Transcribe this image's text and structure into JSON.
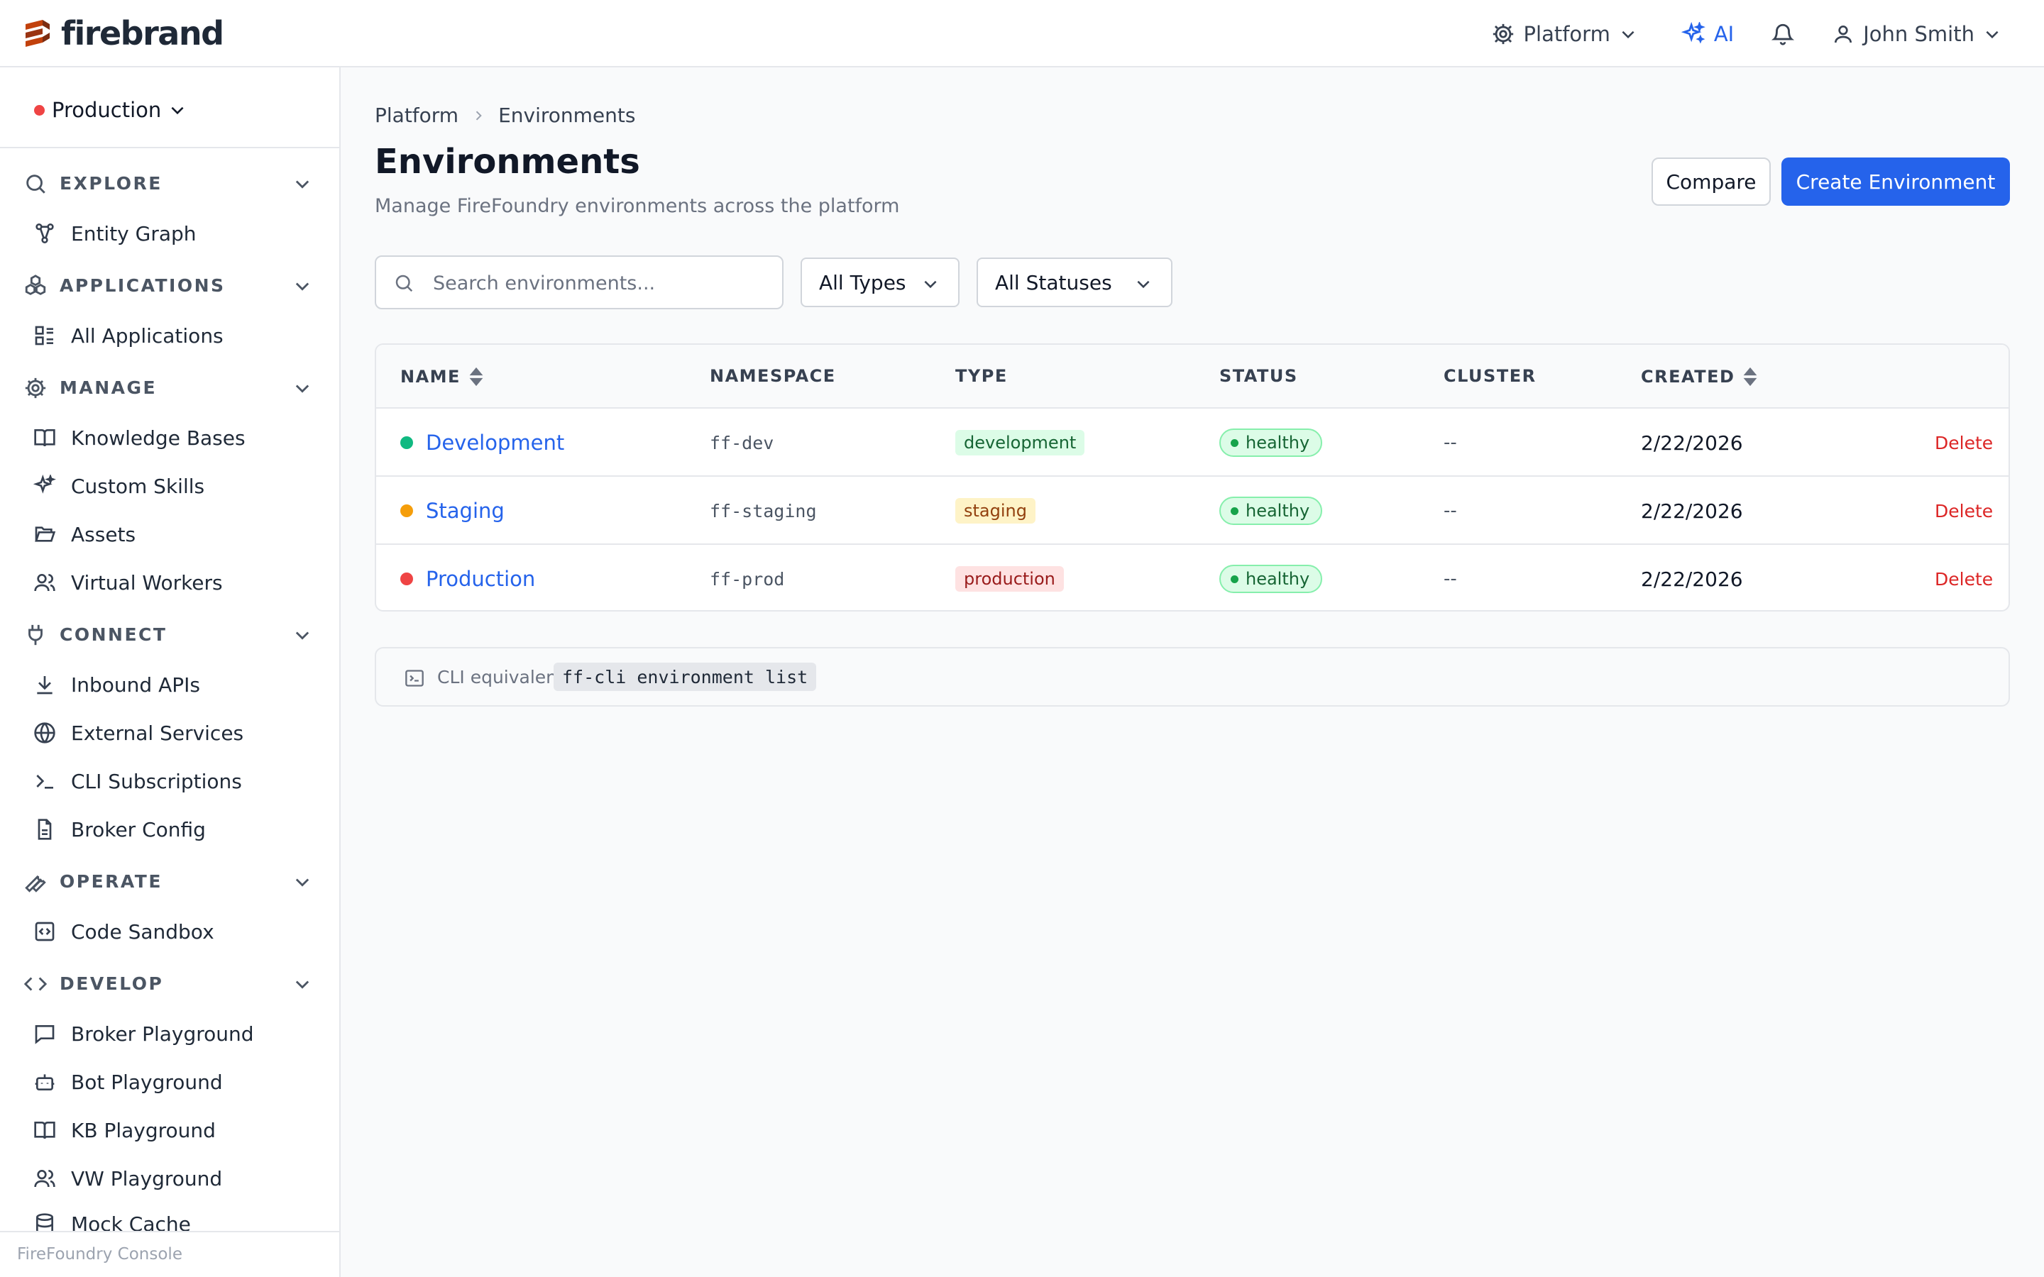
{
  "brand": {
    "name": "firebrand"
  },
  "topbar": {
    "platform_label": "Platform",
    "ai_label": "AI",
    "user_name": "John Smith"
  },
  "sidebar": {
    "environment": "Production",
    "groups": [
      {
        "label": "EXPLORE",
        "items": [
          "Entity Graph"
        ]
      },
      {
        "label": "APPLICATIONS",
        "items": [
          "All Applications"
        ]
      },
      {
        "label": "MANAGE",
        "items": [
          "Knowledge Bases",
          "Custom Skills",
          "Assets",
          "Virtual Workers"
        ]
      },
      {
        "label": "CONNECT",
        "items": [
          "Inbound APIs",
          "External Services",
          "CLI Subscriptions",
          "Broker Config"
        ]
      },
      {
        "label": "OPERATE",
        "items": [
          "Code Sandbox"
        ]
      },
      {
        "label": "DEVELOP",
        "items": [
          "Broker Playground",
          "Bot Playground",
          "KB Playground",
          "VW Playground",
          "Mock Cache"
        ]
      }
    ],
    "footer": "FireFoundry Console"
  },
  "breadcrumb": [
    "Platform",
    "Environments"
  ],
  "page": {
    "title": "Environments",
    "subtitle": "Manage FireFoundry environments across the platform",
    "compare_label": "Compare",
    "create_label": "Create Environment"
  },
  "filters": {
    "search_placeholder": "Search environments...",
    "type_value": "All Types",
    "status_value": "All Statuses"
  },
  "table": {
    "columns": [
      "NAME",
      "NAMESPACE",
      "TYPE",
      "STATUS",
      "CLUSTER",
      "CREATED"
    ],
    "rows": [
      {
        "name": "Development",
        "namespace": "ff-dev",
        "type": "development",
        "status": "healthy",
        "cluster": "--",
        "created": "2/22/2026",
        "action": "Delete"
      },
      {
        "name": "Staging",
        "namespace": "ff-staging",
        "type": "staging",
        "status": "healthy",
        "cluster": "--",
        "created": "2/22/2026",
        "action": "Delete"
      },
      {
        "name": "Production",
        "namespace": "ff-prod",
        "type": "production",
        "status": "healthy",
        "cluster": "--",
        "created": "2/22/2026",
        "action": "Delete"
      }
    ]
  },
  "cli": {
    "label": "CLI equivalent:",
    "command": "ff-cli environment list"
  },
  "colors": {
    "accent": "#2563eb",
    "brand": "#c2410c",
    "development": "#10b981",
    "staging": "#f59e0b",
    "production": "#ef4444",
    "healthy": "#16a34a"
  }
}
